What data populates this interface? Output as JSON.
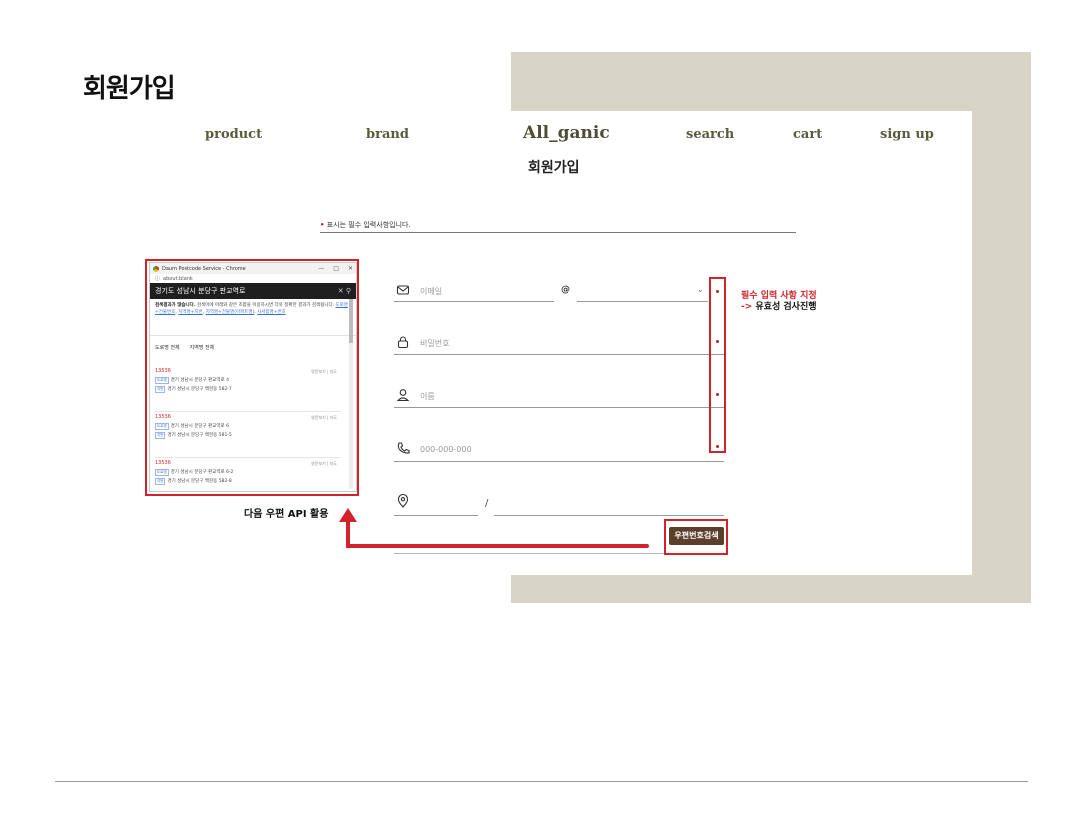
{
  "page": {
    "heading": "회원가입"
  },
  "nav": {
    "product": "product",
    "brand": "brand",
    "logo": "All_ganic",
    "search": "search",
    "cart": "cart",
    "signup": "sign up"
  },
  "form": {
    "title": "회원가입",
    "required_note": "표시는 필수 입력사항입니다.",
    "email_placeholder": "이메일",
    "at_sign": "@",
    "password_placeholder": "비밀번호",
    "name_placeholder": "이름",
    "phone_placeholder": "000-000-000",
    "address_separator": "/",
    "zip_button": "우편번호검색"
  },
  "annotations": {
    "required_label": "필수 입력 사항 지정",
    "validation_arrow": "->",
    "validation_label": "유효성 검사진행",
    "api_caption": "다음 우편 API 활용"
  },
  "popup": {
    "window_title": "Daum Postcode Service - Chrome",
    "address_bar": "about:blank",
    "search_query": "경기도 성남시 분당구 판교역로",
    "desc_bold": "검색결과가 많습니다.",
    "desc_text": " 검색어에 아래와 같은 조합을 이용하시면 더욱 정확한 결과가 검색됩니다.",
    "desc_links": [
      "도로명+건물번호",
      "지역명+지번",
      "지역명+건물명(아파트명)",
      "사서함명+번호"
    ],
    "filter_road": "도로명 전체",
    "filter_region": "지역명 전체",
    "results": [
      {
        "zip": "13536",
        "road": "경기 성남시 분당구 판교역로 4",
        "jibun": "경기 성남시 분당구 백현동 582-7"
      },
      {
        "zip": "13536",
        "road": "경기 성남시 분당구 판교역로 6",
        "jibun": "경기 성남시 분당구 백현동 581-5"
      },
      {
        "zip": "13536",
        "road": "경기 성남시 분당구 판교역로 6-2",
        "jibun": "경기 성남시 분당구 백현동 582-8"
      }
    ],
    "result_links": "영문보기 | 지도",
    "tag_road": "도로명",
    "tag_jibun": "지번"
  },
  "colors": {
    "accent_red": "#d2232a",
    "beige": "#d8d5c6",
    "button_brown": "#5b3f2b",
    "nav_olive": "#5a5a3c"
  },
  "icons": [
    "email-icon",
    "lock-icon",
    "user-icon",
    "phone-icon",
    "location-pin-icon",
    "chevron-down-icon",
    "search-icon",
    "chrome-icon"
  ]
}
